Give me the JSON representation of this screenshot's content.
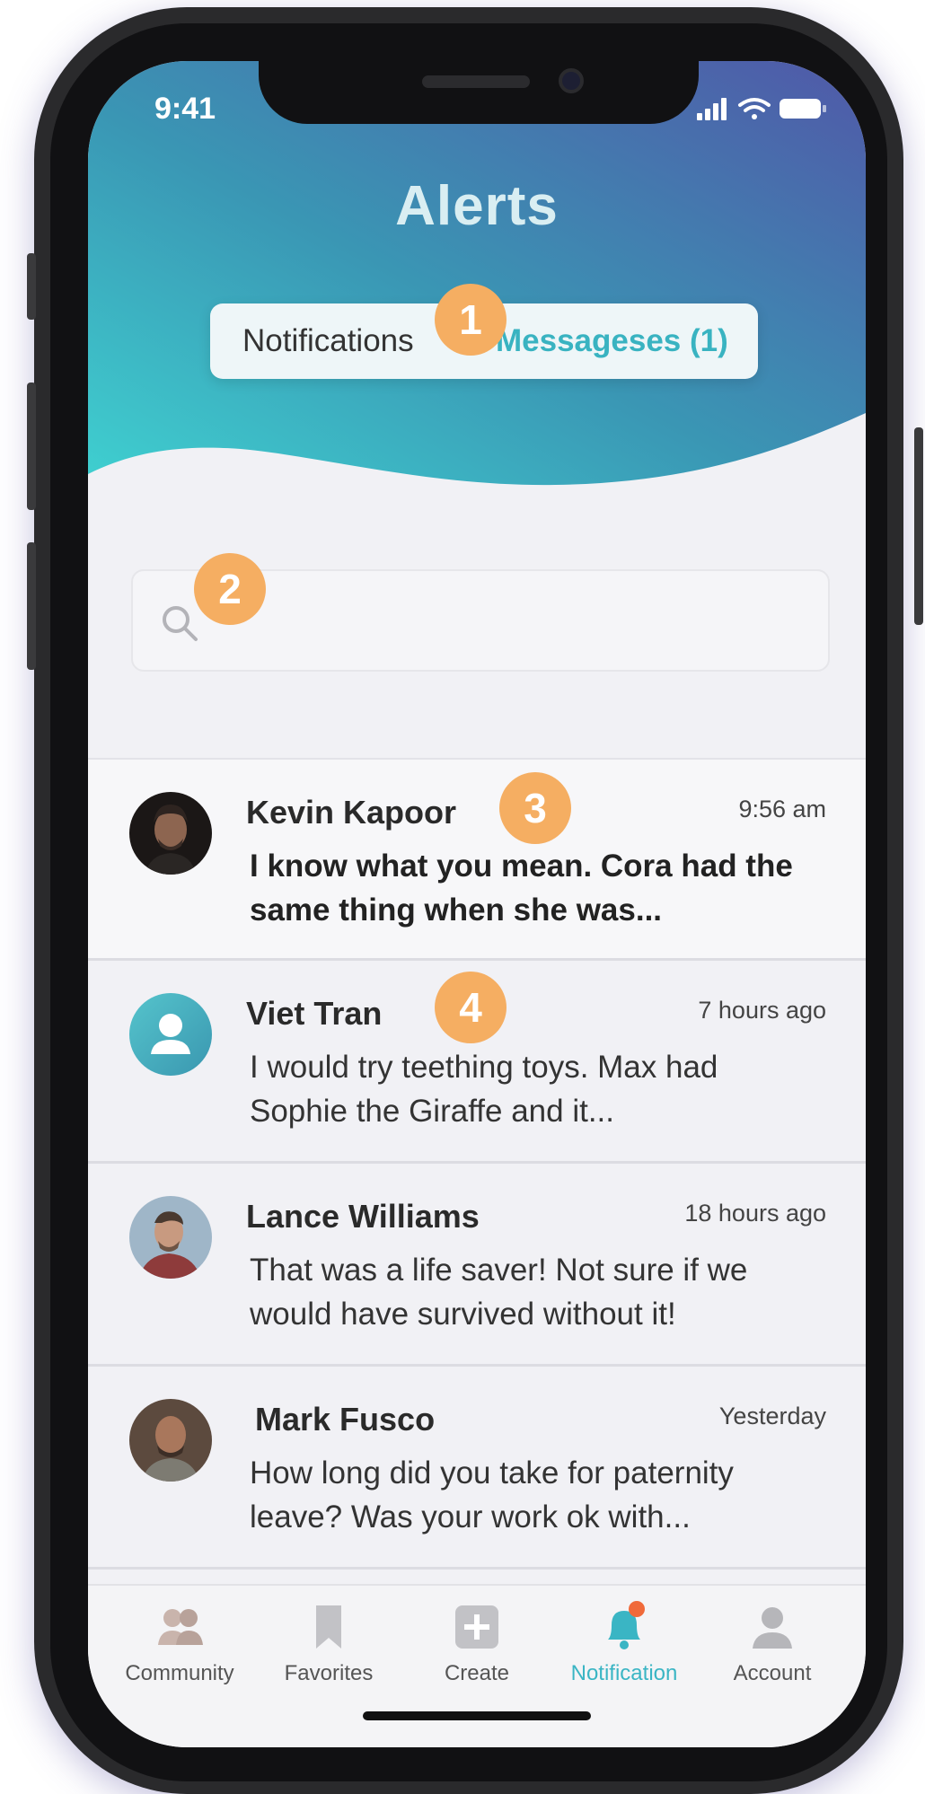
{
  "status_bar": {
    "time": "9:41"
  },
  "header": {
    "title": "Alerts",
    "tabs": [
      {
        "label": "Notifications",
        "active": false
      },
      {
        "label": "Messageses (1)",
        "active": true
      }
    ]
  },
  "callouts": [
    "1",
    "2",
    "3",
    "4"
  ],
  "search": {
    "placeholder": ""
  },
  "messages": [
    {
      "name": "Kevin Kapoor",
      "time": "9:56 am",
      "preview": "I know what you mean. Cora had the same thing when she was...",
      "unread": true
    },
    {
      "name": "Viet Tran",
      "time": "7 hours ago",
      "preview": "I would try teething toys. Max had Sophie the Giraffe and it...",
      "unread": false
    },
    {
      "name": "Lance Williams",
      "time": "18 hours ago",
      "preview": "That was a life saver! Not sure if we would have survived without it!",
      "unread": false
    },
    {
      "name": "Mark Fusco",
      "time": "Yesterday",
      "preview": "How long did you take for paternity leave? Was your work ok with...",
      "unread": false
    }
  ],
  "tab_bar": {
    "items": [
      {
        "label": "Community",
        "icon": "community-icon"
      },
      {
        "label": "Favorites",
        "icon": "bookmark-icon"
      },
      {
        "label": "Create",
        "icon": "plus-icon"
      },
      {
        "label": "Notification",
        "icon": "bell-icon",
        "active": true
      },
      {
        "label": "Account",
        "icon": "user-icon"
      }
    ]
  },
  "colors": {
    "accent": "#39b3c1",
    "header_gradient_start": "#3fc8cc",
    "header_gradient_end": "#4f5aa6",
    "callout": "#f5ae62",
    "notification_dot": "#f06a3a"
  }
}
